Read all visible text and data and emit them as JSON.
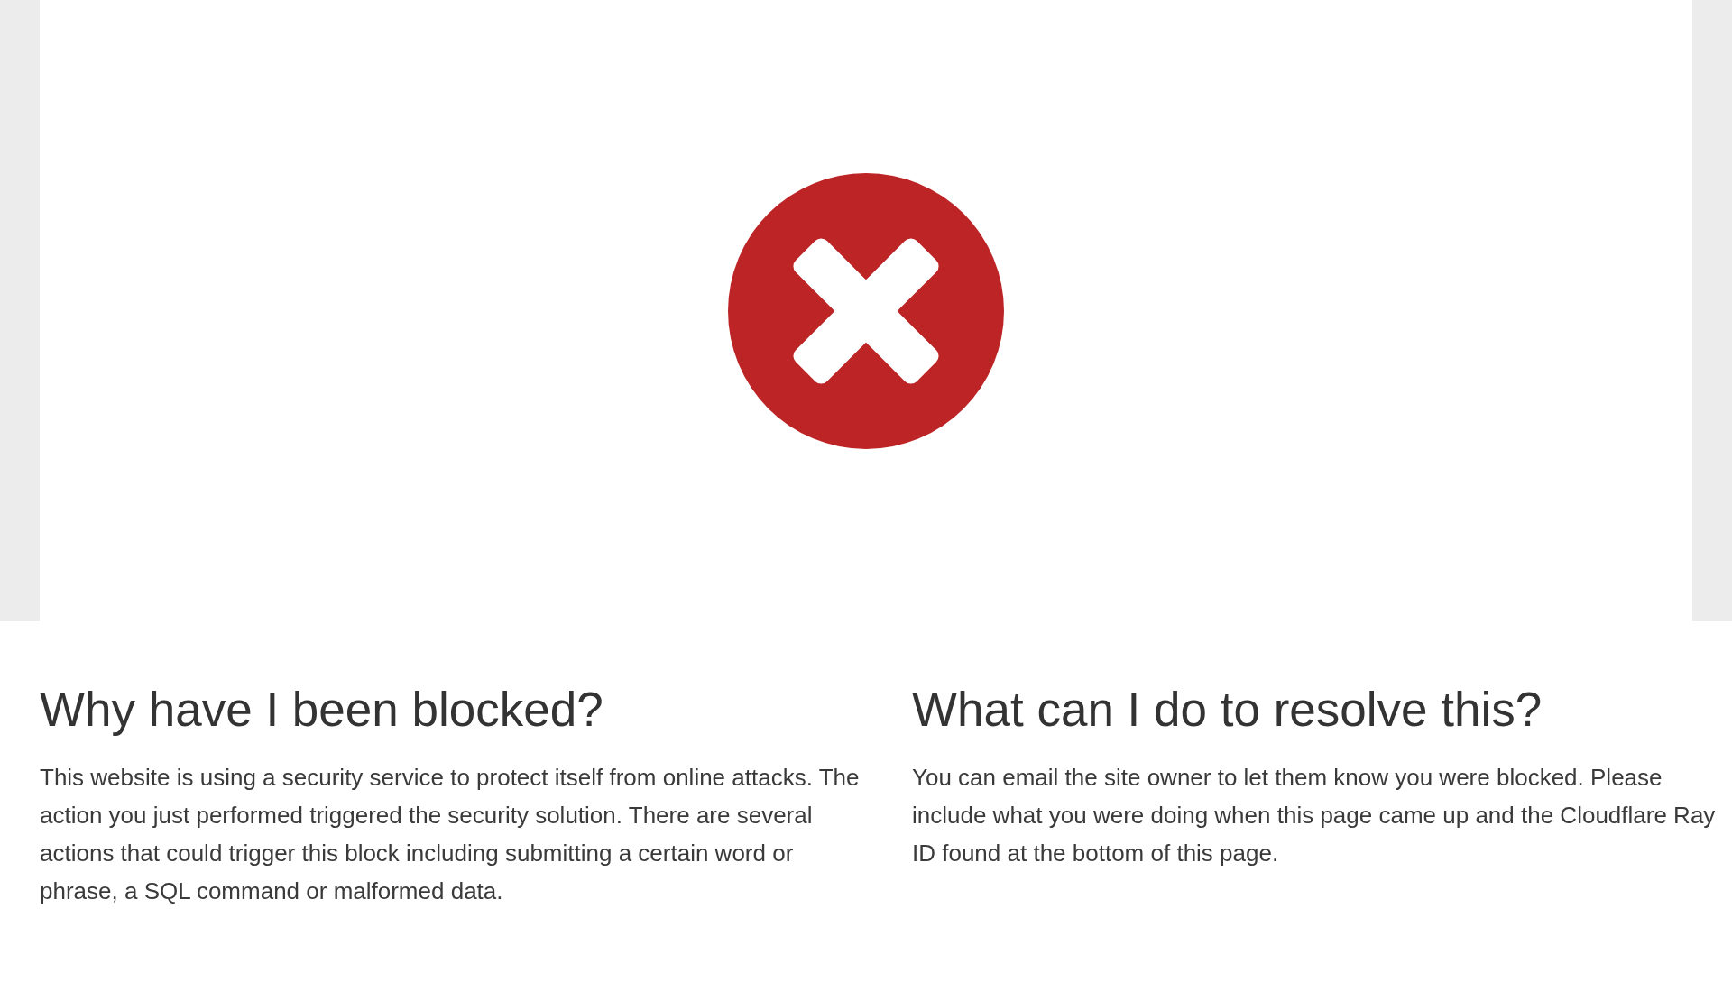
{
  "banner": {
    "kind": "error"
  },
  "sections": [
    {
      "heading": "Why have I been blocked?",
      "text": "This website is using a security service to protect itself from online attacks. The action you just performed triggered the security solution. There are several actions that could trigger this block including submitting a certain word or phrase, a SQL command or malformed data."
    },
    {
      "heading": "What can I do to resolve this?",
      "text": "You can email the site owner to let them know you were blocked. Please include what you were doing when this page came up and the Cloudflare Ray ID found at the bottom of this page."
    }
  ]
}
